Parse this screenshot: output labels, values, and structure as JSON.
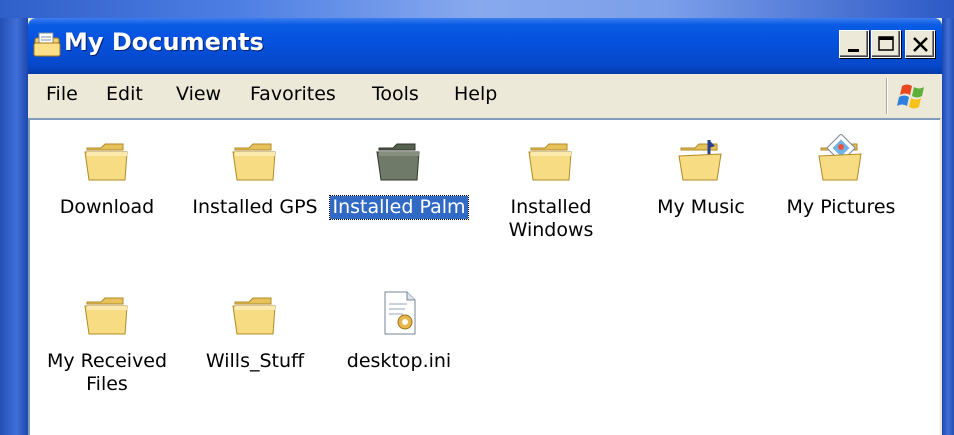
{
  "window": {
    "title": "My Documents",
    "buttons": {
      "minimize": "minimize",
      "maximize": "maximize",
      "close": "close"
    }
  },
  "menu": [
    "File",
    "Edit",
    "View",
    "Favorites",
    "Tools",
    "Help"
  ],
  "items": [
    {
      "name": "Download",
      "lines": [
        "Download"
      ],
      "icon": "folder-icon"
    },
    {
      "name": "Installed GPS",
      "lines": [
        "Installed GPS"
      ],
      "icon": "folder-icon"
    },
    {
      "name": "Installed Palm",
      "lines": [
        "Installed Palm"
      ],
      "icon": "folder-icon",
      "selected": true
    },
    {
      "name": "Installed Windows",
      "lines": [
        "Installed",
        "Windows"
      ],
      "icon": "folder-icon"
    },
    {
      "name": "My Music",
      "lines": [
        "My Music"
      ],
      "icon": "music-folder-icon"
    },
    {
      "name": "My Pictures",
      "lines": [
        "My Pictures"
      ],
      "icon": "pictures-folder-icon"
    },
    {
      "name": "My Received Files",
      "lines": [
        "My Received",
        "Files"
      ],
      "icon": "folder-icon"
    },
    {
      "name": "Wills_Stuff",
      "lines": [
        "Wills_Stuff"
      ],
      "icon": "folder-icon"
    },
    {
      "name": "desktop.ini",
      "lines": [
        "desktop.ini"
      ],
      "icon": "settings-file-icon"
    }
  ],
  "colors": {
    "selection": "#316ac5",
    "titlebar": "#0551df",
    "folder": "#f5d77a"
  }
}
